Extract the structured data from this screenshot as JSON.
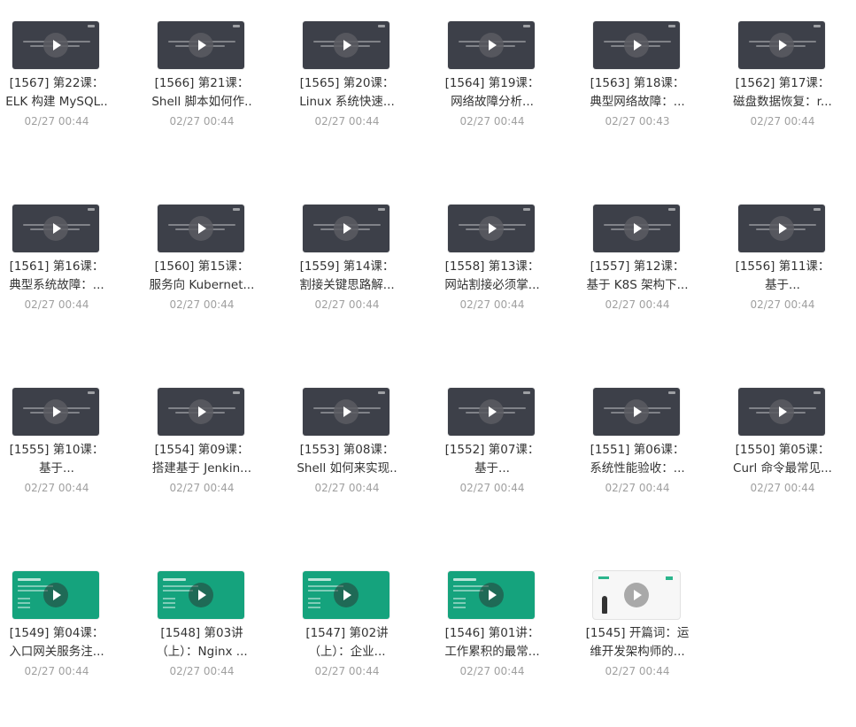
{
  "rows": [
    [
      {
        "l1": "[1567] 第22课：",
        "l2": "ELK 构建 MySQL..",
        "date": "02/27 00:44",
        "thumb": "dark"
      },
      {
        "l1": "[1566] 第21课：",
        "l2": "Shell 脚本如何作..",
        "date": "02/27 00:44",
        "thumb": "dark"
      },
      {
        "l1": "[1565] 第20课：",
        "l2": "Linux 系统快速...",
        "date": "02/27 00:44",
        "thumb": "dark"
      },
      {
        "l1": "[1564] 第19课：",
        "l2": "网络故障分析...",
        "date": "02/27 00:44",
        "thumb": "dark"
      },
      {
        "l1": "[1563] 第18课：",
        "l2": "典型网络故障：...",
        "date": "02/27 00:43",
        "thumb": "dark"
      },
      {
        "l1": "[1562] 第17课：",
        "l2": "磁盘数据恢复：r...",
        "date": "02/27 00:44",
        "thumb": "dark"
      }
    ],
    [
      {
        "l1": "[1561] 第16课：",
        "l2": "典型系统故障：...",
        "date": "02/27 00:44",
        "thumb": "dark"
      },
      {
        "l1": "[1560] 第15课：",
        "l2": "服务向 Kubernet...",
        "date": "02/27 00:44",
        "thumb": "dark"
      },
      {
        "l1": "[1559] 第14课：",
        "l2": "割接关键思路解...",
        "date": "02/27 00:44",
        "thumb": "dark"
      },
      {
        "l1": "[1558] 第13课：",
        "l2": "网站割接必须掌...",
        "date": "02/27 00:44",
        "thumb": "dark"
      },
      {
        "l1": "[1557] 第12课：",
        "l2": "基于 K8S 架构下...",
        "date": "02/27 00:44",
        "thumb": "dark"
      },
      {
        "l1": "[1556] 第11课：",
        "l2": "基于...",
        "date": "02/27 00:44",
        "thumb": "dark"
      }
    ],
    [
      {
        "l1": "[1555] 第10课：",
        "l2": "基于...",
        "date": "02/27 00:44",
        "thumb": "dark"
      },
      {
        "l1": "[1554] 第09课：",
        "l2": "搭建基于 Jenkin...",
        "date": "02/27 00:44",
        "thumb": "dark"
      },
      {
        "l1": "[1553] 第08课：",
        "l2": "Shell 如何来实现..",
        "date": "02/27 00:44",
        "thumb": "dark"
      },
      {
        "l1": "[1552] 第07课：",
        "l2": "基于...",
        "date": "02/27 00:44",
        "thumb": "dark"
      },
      {
        "l1": "[1551] 第06课：",
        "l2": "系统性能验收：...",
        "date": "02/27 00:44",
        "thumb": "dark"
      },
      {
        "l1": "[1550] 第05课：",
        "l2": "Curl 命令最常见...",
        "date": "02/27 00:44",
        "thumb": "dark"
      }
    ],
    [
      {
        "l1": "[1549] 第04课：",
        "l2": "入口网关服务注...",
        "date": "02/27 00:44",
        "thumb": "green"
      },
      {
        "l1": "[1548] 第03讲",
        "l2": "（上）：Nginx ...",
        "date": "02/27 00:44",
        "thumb": "green"
      },
      {
        "l1": "[1547] 第02讲",
        "l2": "（上）：企业...",
        "date": "02/27 00:44",
        "thumb": "green"
      },
      {
        "l1": "[1546] 第01讲：",
        "l2": "工作累积的最常...",
        "date": "02/27 00:44",
        "thumb": "green"
      },
      {
        "l1": "[1545] 开篇词：运",
        "l2": "维开发架构师的...",
        "date": "02/27 00:44",
        "thumb": "white"
      }
    ]
  ]
}
